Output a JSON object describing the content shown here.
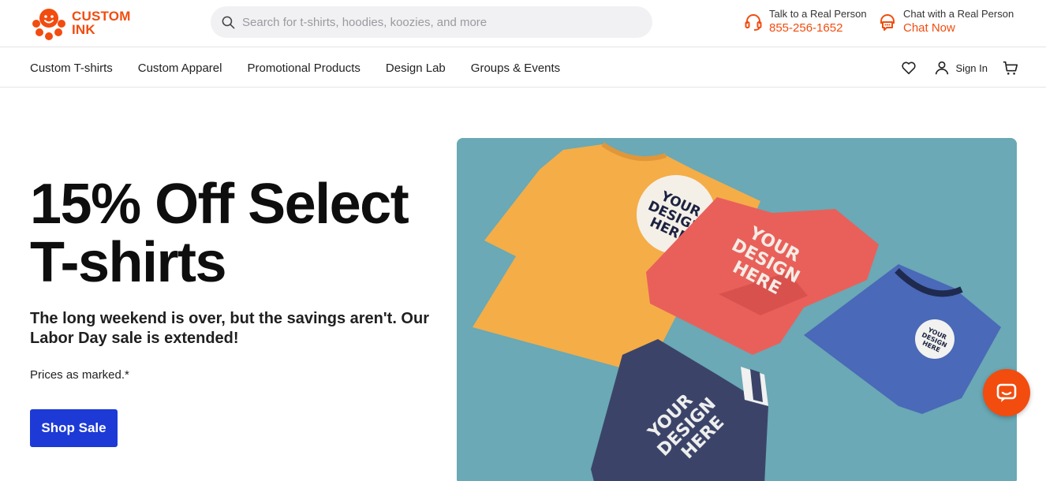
{
  "header": {
    "logo": {
      "line1": "CUSTOM",
      "line2": "INK",
      "icon": "octopus-logo-icon"
    },
    "search": {
      "placeholder": "Search for t-shirts, hoodies, koozies, and more",
      "value": "",
      "icon": "search-icon"
    },
    "phone": {
      "label": "Talk to a Real Person",
      "value": "855-256-1652",
      "icon": "headset-icon"
    },
    "chat": {
      "label": "Chat with a Real Person",
      "value": "Chat Now",
      "icon": "chat-icon"
    },
    "accent_color": "#f24c0f"
  },
  "nav": {
    "items": [
      {
        "label": "Custom T-shirts"
      },
      {
        "label": "Custom Apparel"
      },
      {
        "label": "Promotional Products"
      },
      {
        "label": "Design Lab"
      },
      {
        "label": "Groups & Events"
      }
    ],
    "favorites_icon": "heart-icon",
    "signin_label": "Sign In",
    "signin_icon": "user-icon",
    "cart_icon": "cart-icon"
  },
  "hero": {
    "title": "15% Off Select T-shirts",
    "subtitle": "The long weekend is over, but the savings aren't. Our Labor Day sale is extended!",
    "note": "Prices as marked.*",
    "cta_label": "Shop Sale",
    "cta_color": "#1d3ad6",
    "image": {
      "background": "#6aa9b5",
      "print_text": [
        "YOUR",
        "DESIGN",
        "HERE"
      ]
    }
  },
  "chat_widget": {
    "icon": "chat-bubble-icon"
  }
}
